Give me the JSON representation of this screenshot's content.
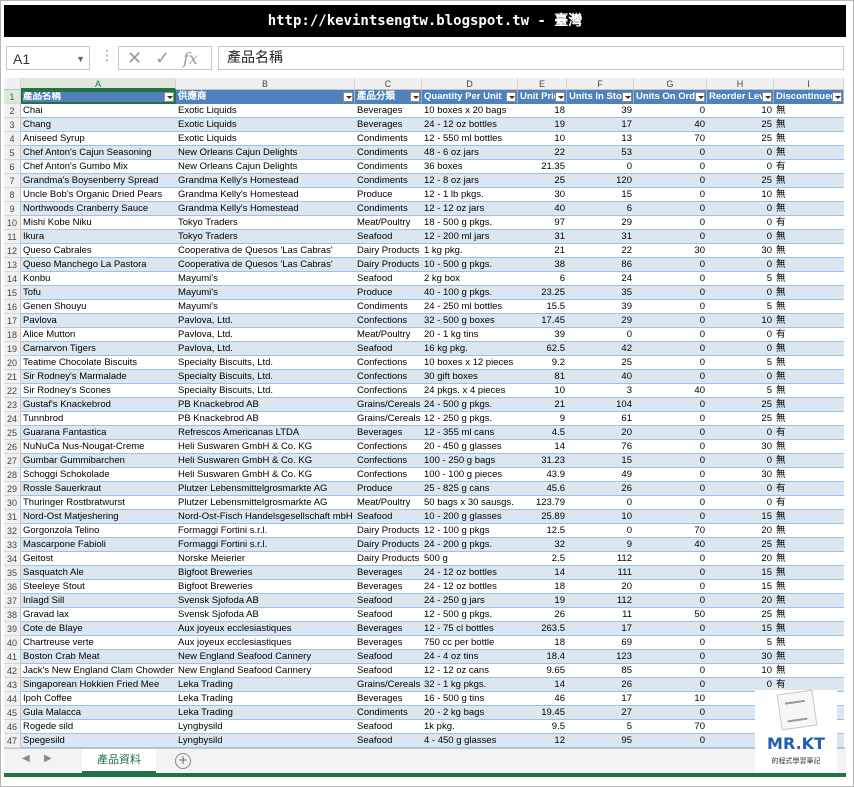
{
  "banner": "http://kevintsengtw.blogspot.tw - 臺灣",
  "formula_bar": {
    "name_box": "A1",
    "content": "產品名稱",
    "cancel_icon": "close-icon",
    "enter_icon": "check-icon",
    "fx_label": "fx"
  },
  "columns": [
    "A",
    "B",
    "C",
    "D",
    "E",
    "F",
    "G",
    "H",
    "I"
  ],
  "headers": [
    "產品名稱",
    "供應商",
    "產品分類",
    "Quantity Per Unit",
    "Unit Price",
    "Units In Stock",
    "Units On Order",
    "Reorder Level",
    "Discontinued"
  ],
  "rows": [
    [
      "Chai",
      "Exotic Liquids",
      "Beverages",
      "10 boxes x 20 bags",
      "18",
      "39",
      "0",
      "10",
      "無"
    ],
    [
      "Chang",
      "Exotic Liquids",
      "Beverages",
      "24 - 12 oz bottles",
      "19",
      "17",
      "40",
      "25",
      "無"
    ],
    [
      "Aniseed Syrup",
      "Exotic Liquids",
      "Condiments",
      "12 - 550 ml bottles",
      "10",
      "13",
      "70",
      "25",
      "無"
    ],
    [
      "Chef Anton's Cajun Seasoning",
      "New Orleans Cajun Delights",
      "Condiments",
      "48 - 6 oz jars",
      "22",
      "53",
      "0",
      "0",
      "無"
    ],
    [
      "Chef Anton's Gumbo Mix",
      "New Orleans Cajun Delights",
      "Condiments",
      "36 boxes",
      "21.35",
      "0",
      "0",
      "0",
      "有"
    ],
    [
      "Grandma's Boysenberry Spread",
      "Grandma Kelly's Homestead",
      "Condiments",
      "12 - 8 oz jars",
      "25",
      "120",
      "0",
      "25",
      "無"
    ],
    [
      "Uncle Bob's Organic Dried Pears",
      "Grandma Kelly's Homestead",
      "Produce",
      "12 - 1 lb pkgs.",
      "30",
      "15",
      "0",
      "10",
      "無"
    ],
    [
      "Northwoods Cranberry Sauce",
      "Grandma Kelly's Homestead",
      "Condiments",
      "12 - 12 oz jars",
      "40",
      "6",
      "0",
      "0",
      "無"
    ],
    [
      "Mishi Kobe Niku",
      "Tokyo Traders",
      "Meat/Poultry",
      "18 - 500 g pkgs.",
      "97",
      "29",
      "0",
      "0",
      "有"
    ],
    [
      "Ikura",
      "Tokyo Traders",
      "Seafood",
      "12 - 200 ml jars",
      "31",
      "31",
      "0",
      "0",
      "無"
    ],
    [
      "Queso Cabrales",
      "Cooperativa de Quesos 'Las Cabras'",
      "Dairy Products",
      "1 kg pkg.",
      "21",
      "22",
      "30",
      "30",
      "無"
    ],
    [
      "Queso Manchego La Pastora",
      "Cooperativa de Quesos 'Las Cabras'",
      "Dairy Products",
      "10 - 500 g pkgs.",
      "38",
      "86",
      "0",
      "0",
      "無"
    ],
    [
      "Konbu",
      "Mayumi's",
      "Seafood",
      "2 kg box",
      "6",
      "24",
      "0",
      "5",
      "無"
    ],
    [
      "Tofu",
      "Mayumi's",
      "Produce",
      "40 - 100 g pkgs.",
      "23.25",
      "35",
      "0",
      "0",
      "無"
    ],
    [
      "Genen Shouyu",
      "Mayumi's",
      "Condiments",
      "24 - 250 ml bottles",
      "15.5",
      "39",
      "0",
      "5",
      "無"
    ],
    [
      "Pavlova",
      "Pavlova, Ltd.",
      "Confections",
      "32 - 500 g boxes",
      "17.45",
      "29",
      "0",
      "10",
      "無"
    ],
    [
      "Alice Mutton",
      "Pavlova, Ltd.",
      "Meat/Poultry",
      "20 - 1 kg tins",
      "39",
      "0",
      "0",
      "0",
      "有"
    ],
    [
      "Carnarvon Tigers",
      "Pavlova, Ltd.",
      "Seafood",
      "16 kg pkg.",
      "62.5",
      "42",
      "0",
      "0",
      "無"
    ],
    [
      "Teatime Chocolate Biscuits",
      "Specialty Biscuits, Ltd.",
      "Confections",
      "10 boxes x 12 pieces",
      "9.2",
      "25",
      "0",
      "5",
      "無"
    ],
    [
      "Sir Rodney's Marmalade",
      "Specialty Biscuits, Ltd.",
      "Confections",
      "30 gift boxes",
      "81",
      "40",
      "0",
      "0",
      "無"
    ],
    [
      "Sir Rodney's Scones",
      "Specialty Biscuits, Ltd.",
      "Confections",
      "24 pkgs. x 4 pieces",
      "10",
      "3",
      "40",
      "5",
      "無"
    ],
    [
      "Gustaf's Knackebrod",
      "PB Knackebrod AB",
      "Grains/Cereals",
      "24 - 500 g pkgs.",
      "21",
      "104",
      "0",
      "25",
      "無"
    ],
    [
      "Tunnbrod",
      "PB Knackebrod AB",
      "Grains/Cereals",
      "12 - 250 g pkgs.",
      "9",
      "61",
      "0",
      "25",
      "無"
    ],
    [
      "Guarana Fantastica",
      "Refrescos Americanas LTDA",
      "Beverages",
      "12 - 355 ml cans",
      "4.5",
      "20",
      "0",
      "0",
      "有"
    ],
    [
      "NuNuCa Nus-Nougat-Creme",
      "Heli Suswaren GmbH & Co. KG",
      "Confections",
      "20 - 450 g glasses",
      "14",
      "76",
      "0",
      "30",
      "無"
    ],
    [
      "Gumbar Gummibarchen",
      "Heli Suswaren GmbH & Co. KG",
      "Confections",
      "100 - 250 g bags",
      "31.23",
      "15",
      "0",
      "0",
      "無"
    ],
    [
      "Schoggi Schokolade",
      "Heli Suswaren GmbH & Co. KG",
      "Confections",
      "100 - 100 g pieces",
      "43.9",
      "49",
      "0",
      "30",
      "無"
    ],
    [
      "Rossle Sauerkraut",
      "Plutzer Lebensmittelgrosmarkte AG",
      "Produce",
      "25 - 825 g cans",
      "45.6",
      "26",
      "0",
      "0",
      "有"
    ],
    [
      "Thuringer Rostbratwurst",
      "Plutzer Lebensmittelgrosmarkte AG",
      "Meat/Poultry",
      "50 bags x 30 sausgs.",
      "123.79",
      "0",
      "0",
      "0",
      "有"
    ],
    [
      "Nord-Ost Matjeshering",
      "Nord-Ost-Fisch Handelsgesellschaft mbH",
      "Seafood",
      "10 - 200 g glasses",
      "25.89",
      "10",
      "0",
      "15",
      "無"
    ],
    [
      "Gorgonzola Telino",
      "Formaggi Fortini s.r.l.",
      "Dairy Products",
      "12 - 100 g pkgs",
      "12.5",
      "0",
      "70",
      "20",
      "無"
    ],
    [
      "Mascarpone Fabioli",
      "Formaggi Fortini s.r.l.",
      "Dairy Products",
      "24 - 200 g pkgs.",
      "32",
      "9",
      "40",
      "25",
      "無"
    ],
    [
      "Geitost",
      "Norske Meierier",
      "Dairy Products",
      "500 g",
      "2.5",
      "112",
      "0",
      "20",
      "無"
    ],
    [
      "Sasquatch Ale",
      "Bigfoot Breweries",
      "Beverages",
      "24 - 12 oz bottles",
      "14",
      "111",
      "0",
      "15",
      "無"
    ],
    [
      "Steeleye Stout",
      "Bigfoot Breweries",
      "Beverages",
      "24 - 12 oz bottles",
      "18",
      "20",
      "0",
      "15",
      "無"
    ],
    [
      "Inlagd Sill",
      "Svensk Sjofoda AB",
      "Seafood",
      "24 - 250 g  jars",
      "19",
      "112",
      "0",
      "20",
      "無"
    ],
    [
      "Gravad lax",
      "Svensk Sjofoda AB",
      "Seafood",
      "12 - 500 g pkgs.",
      "26",
      "11",
      "50",
      "25",
      "無"
    ],
    [
      "Cote de Blaye",
      "Aux joyeux ecclesiastiques",
      "Beverages",
      "12 - 75 cl bottles",
      "263.5",
      "17",
      "0",
      "15",
      "無"
    ],
    [
      "Chartreuse verte",
      "Aux joyeux ecclesiastiques",
      "Beverages",
      "750 cc per bottle",
      "18",
      "69",
      "0",
      "5",
      "無"
    ],
    [
      "Boston Crab Meat",
      "New England Seafood Cannery",
      "Seafood",
      "24 - 4 oz tins",
      "18.4",
      "123",
      "0",
      "30",
      "無"
    ],
    [
      "Jack's New England Clam Chowder",
      "New England Seafood Cannery",
      "Seafood",
      "12 - 12 oz cans",
      "9.65",
      "85",
      "0",
      "10",
      "無"
    ],
    [
      "Singaporean Hokkien Fried Mee",
      "Leka Trading",
      "Grains/Cereals",
      "32 - 1 kg pkgs.",
      "14",
      "26",
      "0",
      "0",
      "有"
    ],
    [
      "Ipoh Coffee",
      "Leka Trading",
      "Beverages",
      "16 - 500 g tins",
      "46",
      "17",
      "10",
      "",
      ""
    ],
    [
      "Gula Malacca",
      "Leka Trading",
      "Condiments",
      "20 - 2 kg bags",
      "19.45",
      "27",
      "0",
      "",
      ""
    ],
    [
      "Rogede sild",
      "Lyngbysild",
      "Seafood",
      "1k pkg.",
      "9.5",
      "5",
      "70",
      "",
      ""
    ],
    [
      "Spegesild",
      "Lyngbysild",
      "Seafood",
      "4 - 450 g glasses",
      "12",
      "95",
      "0",
      "",
      ""
    ]
  ],
  "sheet_tab": "產品資料",
  "logo": {
    "brand": "MR.KT",
    "sub": "的程式學習筆記"
  },
  "colors": {
    "header_bg": "#4f81bd",
    "band_bg": "#dce6f1",
    "excel_green": "#217346"
  }
}
